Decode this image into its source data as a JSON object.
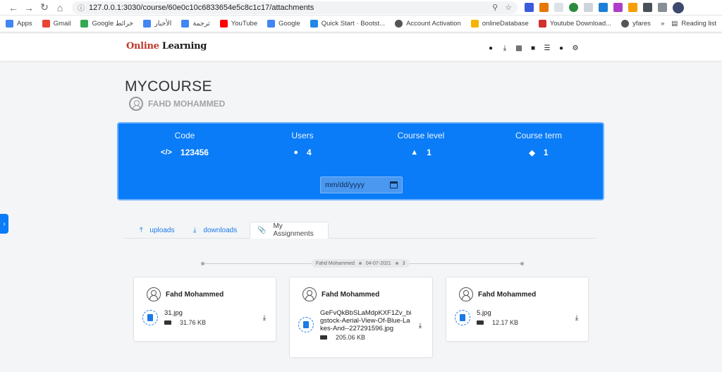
{
  "browser": {
    "url": "127.0.0.1:3030/course/60e0c10c6833654e5c8c1c17/attachments",
    "bookmarks": [
      {
        "label": "Apps",
        "color": "#4285f4"
      },
      {
        "label": "Gmail",
        "color": "#ea4335"
      },
      {
        "label": "Google خرائط",
        "color": "#34a853"
      },
      {
        "label": "الأخبار",
        "color": "#4285f4"
      },
      {
        "label": "ترجمة",
        "color": "#4285f4"
      },
      {
        "label": "YouTube",
        "color": "#ff0000"
      },
      {
        "label": "Google",
        "color": "#4285f4"
      },
      {
        "label": "Quick Start · Bootst...",
        "color": "#1e88e5"
      },
      {
        "label": "Account Activation",
        "color": "#555555"
      },
      {
        "label": "onlineDatabase",
        "color": "#f4b400"
      },
      {
        "label": "Youtube Download...",
        "color": "#d32f2f"
      },
      {
        "label": "yfares",
        "color": "#555555"
      }
    ],
    "reading_list": "Reading list"
  },
  "app": {
    "logo_prefix": "Online",
    "logo_suffix": "Learning"
  },
  "course": {
    "title": "MYCOURSE",
    "instructor": "FAHD MOHAMMED"
  },
  "stats": {
    "code_label": "Code",
    "code_value": "123456",
    "users_label": "Users",
    "users_value": "4",
    "level_label": "Course level",
    "level_value": "1",
    "term_label": "Course term",
    "term_value": "1",
    "date_placeholder": "mm/dd/yyyy"
  },
  "tabs": [
    {
      "label": "uploads"
    },
    {
      "label": "downloads"
    },
    {
      "label": "My Assignments"
    }
  ],
  "timeline": {
    "author": "Fahd Mohammed",
    "date": "04-07-2021",
    "count": "3"
  },
  "files": [
    {
      "owner": "Fahd Mohammed",
      "name": "31.jpg",
      "size": "31.76 KB"
    },
    {
      "owner": "Fahd Mohammed",
      "name": "GeFvQkBbSLaMdpKXF1Zv_bigstock-Aerial-View-Of-Blue-Lakes-And--227291596.jpg",
      "size": "205.06 KB"
    },
    {
      "owner": "Fahd Mohammed",
      "name": "5.jpg",
      "size": "12.17 KB"
    }
  ],
  "colors": {
    "primary": "#0a7cf7",
    "link": "#1a7ae8"
  }
}
